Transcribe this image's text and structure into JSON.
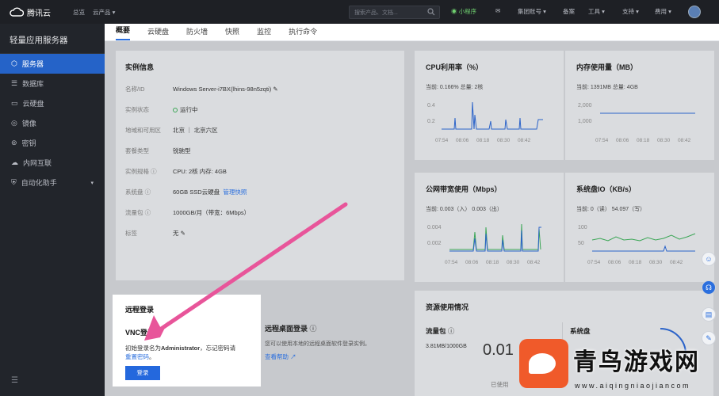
{
  "topbar": {
    "logo": "腾讯云",
    "overview": "总览",
    "products": "云产品",
    "search_placeholder": "搜索产品、文档...",
    "mini_program": "小程序",
    "group_account": "集团账号",
    "icp": "备案",
    "tools": "工具",
    "support": "支持",
    "billing": "费用"
  },
  "sidebar": {
    "title": "轻量应用服务器",
    "items": [
      {
        "label": "服务器",
        "icon": "cube-icon"
      },
      {
        "label": "数据库",
        "icon": "database-icon"
      },
      {
        "label": "云硬盘",
        "icon": "disk-icon"
      },
      {
        "label": "镜像",
        "icon": "image-icon"
      },
      {
        "label": "密钥",
        "icon": "key-icon"
      },
      {
        "label": "内网互联",
        "icon": "cloud-icon"
      },
      {
        "label": "自动化助手",
        "icon": "shield-icon"
      }
    ]
  },
  "tabs": [
    "概要",
    "云硬盘",
    "防火墙",
    "快照",
    "监控",
    "执行命令"
  ],
  "instance": {
    "title": "实例信息",
    "rows": [
      {
        "k": "名称/ID",
        "v": "Windows Server-i7BX(lhins-98n5zqti)"
      },
      {
        "k": "实例状态",
        "v": "运行中"
      },
      {
        "k": "地域和可用区",
        "v": "北京 ｜ 北京六区"
      },
      {
        "k": "套餐类型",
        "v": "锐驰型"
      },
      {
        "k": "实例规格",
        "v": "CPU: 2核 内存: 4GB"
      },
      {
        "k": "系统盘",
        "v": "60GB SSD云硬盘",
        "link": "管理快照"
      },
      {
        "k": "流量包",
        "v": "1000GB/月（带宽：6Mbps）"
      },
      {
        "k": "标签",
        "v": "无"
      }
    ]
  },
  "metrics": [
    {
      "title": "CPU利用率（%）",
      "current": "当前: 0.166% 总量: 2核",
      "yticks": [
        "0.4",
        "0.2"
      ],
      "xticks": [
        "07:54",
        "08:06",
        "08:18",
        "08:30",
        "08:42"
      ]
    },
    {
      "title": "内存使用量（MB）",
      "current": "当前: 1391MB 总量: 4GB",
      "yticks": [
        "2,000",
        "1,000"
      ],
      "xticks": [
        "07:54",
        "08:06",
        "08:18",
        "08:30",
        "08:42"
      ]
    },
    {
      "title": "公网带宽使用（Mbps）",
      "current": "当前: 0.003（入） 0.003（出）",
      "yticks": [
        "0.004",
        "0.002"
      ],
      "xticks": [
        "07:54",
        "08:06",
        "08:18",
        "08:30",
        "08:42"
      ]
    },
    {
      "title": "系统盘IO（KB/s）",
      "current": "当前: 0（读） 54.097（写）",
      "yticks": [
        "100",
        "50"
      ],
      "xticks": [
        "07:54",
        "08:06",
        "08:18",
        "08:30",
        "08:42"
      ]
    }
  ],
  "remote": {
    "title": "远程登录",
    "vnc": "VNC登录",
    "desc_prefix": "初始登录名为",
    "desc_user": "Administrator",
    "desc_suffix": "，忘记密码请",
    "reset": "重置密码",
    "reset_suffix": "。",
    "login_button": "登录"
  },
  "rdp": {
    "title": "远程桌面登录",
    "desc": "您可以使用本地的远程桌面软件登录实例。",
    "help": "查看帮助"
  },
  "resources": {
    "title": "资源使用情况",
    "traffic_label": "流量包",
    "traffic_value": "3.81MB/1000GB",
    "traffic_big": "0.01",
    "used": "已使用",
    "disk_label": "系统盘"
  },
  "watermark": {
    "text": "青鸟游戏网",
    "url": "www.aiqingniaojiancom"
  }
}
